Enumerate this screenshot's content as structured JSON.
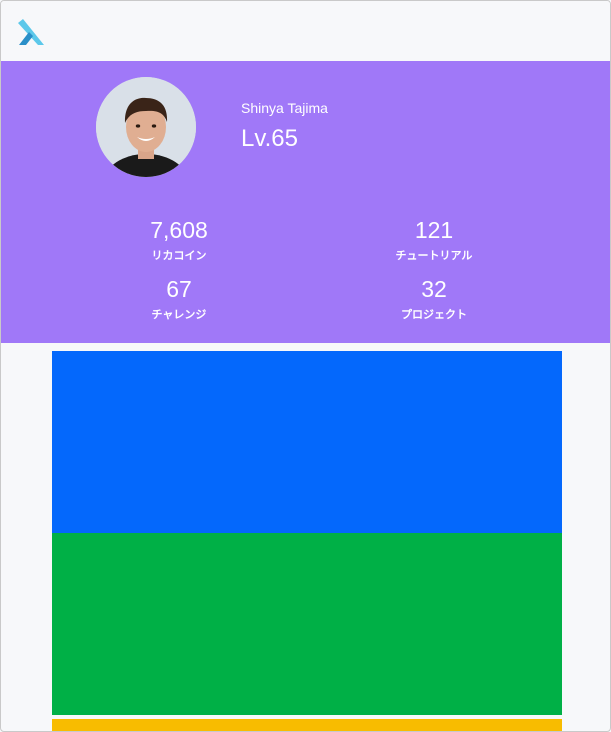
{
  "user": {
    "name": "Shinya Tajima",
    "level": "Lv.65"
  },
  "stats": {
    "coins": {
      "value": "7,608",
      "label": "リカコイン"
    },
    "tutorials": {
      "value": "121",
      "label": "チュートリアル"
    },
    "challenges": {
      "value": "67",
      "label": "チャレンジ"
    },
    "projects": {
      "value": "32",
      "label": "プロジェクト"
    }
  },
  "colors": {
    "profile_bg": "#a078f8",
    "card_1": "#0468fc",
    "card_2": "#00b046",
    "card_3": "#f8bc00",
    "logo_light": "#5cc8ea",
    "logo_dark": "#2a8fc8"
  },
  "icons": {
    "logo": "lambda-logo-icon",
    "avatar": "user-avatar"
  }
}
